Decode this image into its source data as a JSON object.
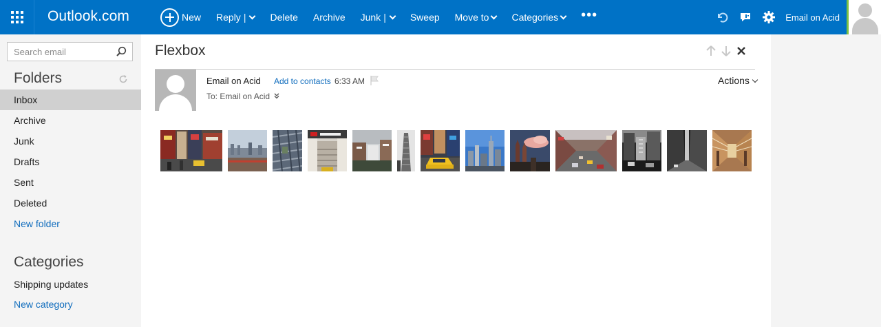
{
  "topbar": {
    "brand": "Outlook.com",
    "commands": {
      "new": "New",
      "reply": "Reply",
      "delete": "Delete",
      "archive": "Archive",
      "junk": "Junk",
      "sweep": "Sweep",
      "move_to": "Move to",
      "categories": "Categories",
      "more": "•••"
    },
    "user_name": "Email on Acid",
    "accent_color": "#0072c6"
  },
  "sidebar": {
    "search_placeholder": "Search email",
    "folders_title": "Folders",
    "folders": [
      {
        "label": "Inbox",
        "selected": true
      },
      {
        "label": "Archive",
        "selected": false
      },
      {
        "label": "Junk",
        "selected": false
      },
      {
        "label": "Drafts",
        "selected": false
      },
      {
        "label": "Sent",
        "selected": false
      },
      {
        "label": "Deleted",
        "selected": false
      }
    ],
    "new_folder": "New folder",
    "categories_title": "Categories",
    "categories": [
      {
        "label": "Shipping updates"
      }
    ],
    "new_category": "New category"
  },
  "message": {
    "subject": "Flexbox",
    "sender": "Email on Acid",
    "add_contacts": "Add to contacts",
    "time": "6:33 AM",
    "to_line": "To: Email on Acid",
    "actions_label": "Actions",
    "photos": [
      {
        "name": "times-square-crowd"
      },
      {
        "name": "skyline-over-water"
      },
      {
        "name": "aerial-city-grid"
      },
      {
        "name": "subway-stairs"
      },
      {
        "name": "snowy-rooftops"
      },
      {
        "name": "flatiron-building"
      },
      {
        "name": "yellow-taxi"
      },
      {
        "name": "midtown-skyline-blue-sky"
      },
      {
        "name": "twin-towers-pink-cloud"
      },
      {
        "name": "busy-avenue"
      },
      {
        "name": "bw-street-scene"
      },
      {
        "name": "bw-street-canyon"
      },
      {
        "name": "subway-car-interior"
      }
    ]
  }
}
